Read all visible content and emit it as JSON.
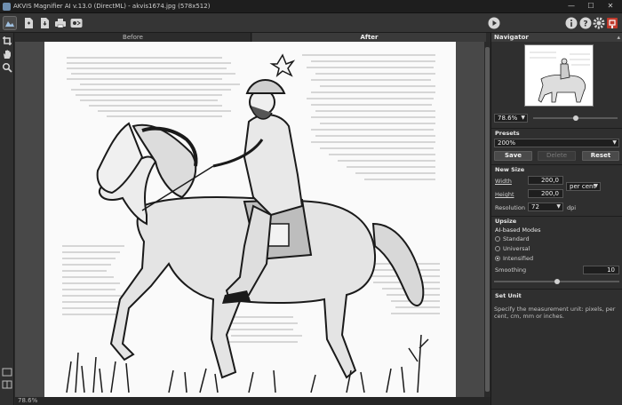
{
  "window": {
    "title": "AKVIS Magnifier AI v.13.0 (DirectML) - akvis1674.jpg (578x512)",
    "minimize": "—",
    "maximize": "☐",
    "close": "✕"
  },
  "toolbar": {
    "left_icons": [
      "home-icon",
      "open-file-icon",
      "save-file-icon",
      "print-icon",
      "share-icon"
    ],
    "right_icons": [
      "run-icon",
      "info-icon",
      "help-icon",
      "settings-icon",
      "notification-icon"
    ]
  },
  "tools": [
    "crop-icon",
    "hand-icon",
    "zoom-icon"
  ],
  "tabs": {
    "before": "Before",
    "after": "After"
  },
  "status": {
    "zoom": "78.6%"
  },
  "navigator": {
    "title": "Navigator",
    "zoom": "78.6%",
    "zoom_level": 0.5
  },
  "presets": {
    "title": "Presets",
    "value": "200%",
    "save": "Save",
    "delete": "Delete",
    "reset": "Reset"
  },
  "new_size": {
    "title": "New Size",
    "width_label": "Width",
    "width": "200,0",
    "height_label": "Height",
    "height": "200,0",
    "unit": "per cent",
    "resolution_label": "Resolution",
    "resolution": "72",
    "resolution_unit": "dpi"
  },
  "upsize": {
    "title": "Upsize",
    "modes_label": "AI-based Modes",
    "modes": [
      "Standard",
      "Universal",
      "Intensified"
    ],
    "selected_mode": "Intensified",
    "smoothing_label": "Smoothing",
    "smoothing": "10",
    "smoothing_level": 0.5
  },
  "hint": {
    "title": "Set Unit",
    "text": "Specify the measurement unit: pixels, per cent, cm, mm or inches."
  },
  "colors": {
    "accent": "#6f8fb0",
    "close_button": "#c0392b"
  }
}
